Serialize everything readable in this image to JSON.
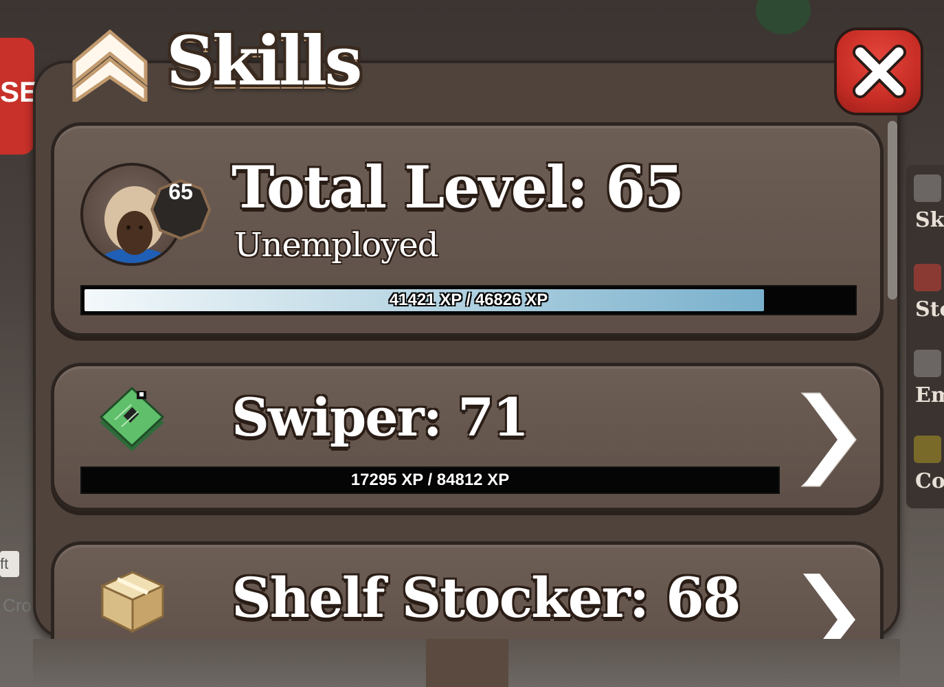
{
  "window": {
    "title": "Skills"
  },
  "total": {
    "title": "Total Level: 65",
    "job": "Unemployed",
    "level_badge": "65",
    "xp_text": "41421 XP / 46826 XP",
    "xp_current": 41421,
    "xp_max": 46826
  },
  "skills": [
    {
      "title": "Swiper: 71",
      "xp_text": "17295 XP / 84812 XP",
      "xp_current": 17295,
      "xp_max": 84812,
      "icon": "circuit-board-icon"
    },
    {
      "title": "Shelf Stocker: 68",
      "icon": "cardboard-box-icon"
    }
  ],
  "side_menu": [
    "Ski",
    "Sto",
    "Emo",
    "Coo"
  ],
  "background": {
    "left_tag": "ft",
    "left_text": "Cro",
    "stop_text": "SE"
  },
  "colors": {
    "close_button": "#c72d25",
    "panel": "#4f433c",
    "card": "#64554d",
    "xp_fill": "#9ec6da"
  }
}
